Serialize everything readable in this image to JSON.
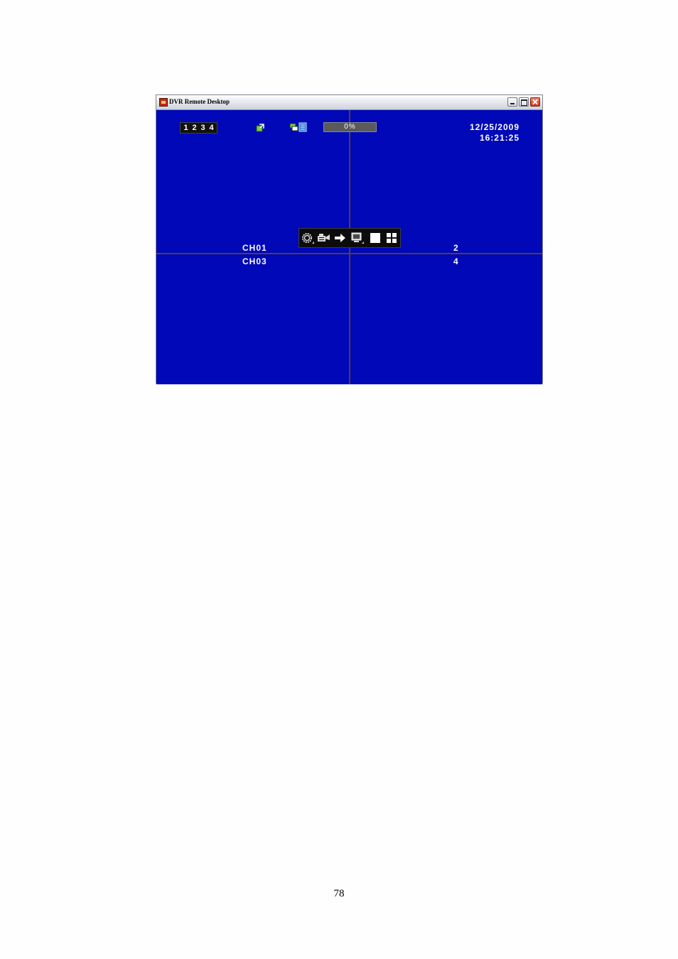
{
  "window": {
    "title": "DVR Remote Desktop"
  },
  "title_buttons": {
    "minimize": "minimize-icon",
    "maximize": "maximize-icon",
    "close": "close-icon"
  },
  "status_bar": {
    "channels": [
      "1",
      "2",
      "3",
      "4"
    ],
    "network_icon": "network-status-icon",
    "hdd_icon": "hdd-status-icon",
    "progress_text": "0%",
    "progress_value": 0,
    "date": "12/25/2009",
    "time": "16:21:25"
  },
  "toolbar": {
    "buttons": [
      {
        "name": "setup",
        "icon": "gear-icon"
      },
      {
        "name": "record",
        "icon": "camera-icon"
      },
      {
        "name": "next",
        "icon": "arrow-right-icon"
      },
      {
        "name": "monitor",
        "icon": "monitor-icon"
      },
      {
        "name": "single-view",
        "icon": "single-screen-icon"
      },
      {
        "name": "quad-view",
        "icon": "quad-screen-icon"
      }
    ]
  },
  "channels": {
    "ch1": "CH01",
    "ch2": "2",
    "ch3": "CH03",
    "ch4": "4"
  },
  "colors": {
    "screen_background": "#0008b8",
    "divider": "#5a3d3d",
    "toolbar_background": "#0c0c0c"
  },
  "page": {
    "number": "78"
  }
}
